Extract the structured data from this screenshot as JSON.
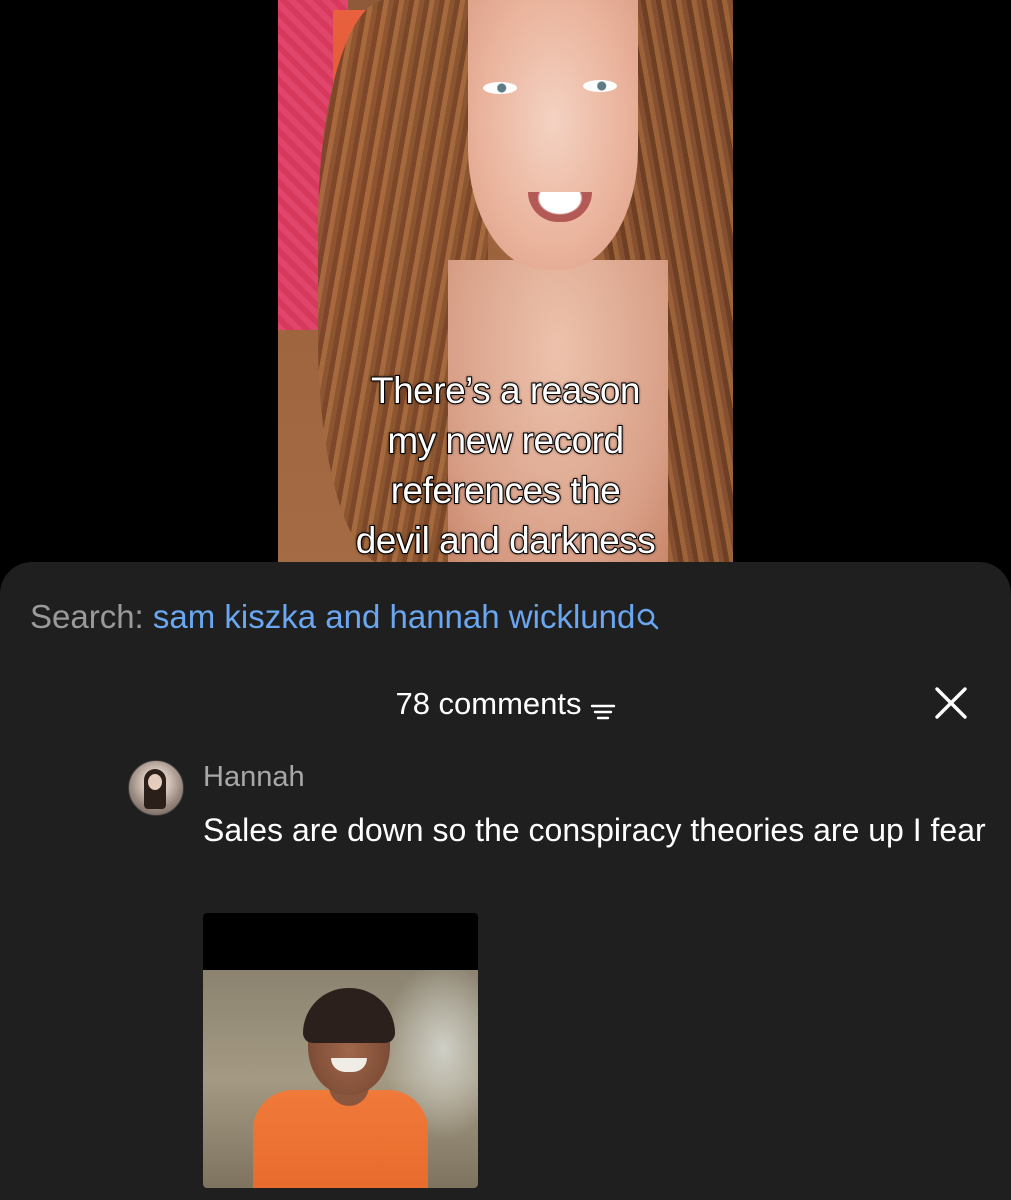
{
  "video": {
    "caption_lines": [
      "There’s a reason",
      "my new record",
      "references the",
      "devil and darkness"
    ]
  },
  "search": {
    "label": "Search:",
    "query": "sam kiszka and hannah wicklund",
    "icon": "search-icon",
    "accent_color": "#6aa7f0"
  },
  "comments_panel": {
    "count_label": "78 comments",
    "sort_icon": "sort-icon",
    "close_icon": "close-icon",
    "background_color": "#1f1f1f"
  },
  "comments": [
    {
      "username": "Hannah",
      "text": "Sales are down so the conspiracy theories are up I fear",
      "has_media": true
    }
  ]
}
